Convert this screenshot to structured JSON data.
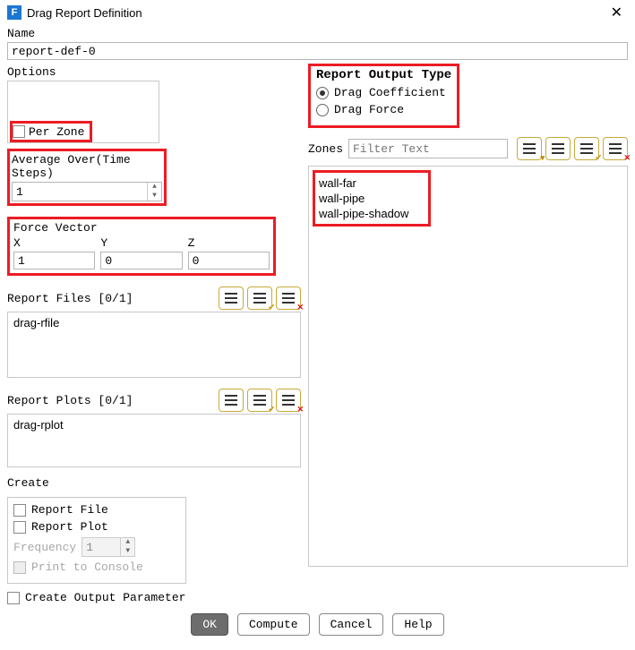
{
  "window": {
    "title": "Drag Report Definition",
    "icon_letter": "F"
  },
  "name": {
    "label": "Name",
    "value": "report-def-0"
  },
  "options": {
    "label": "Options",
    "per_zone": "Per Zone",
    "avg_over_label": "Average Over(Time Steps)",
    "avg_over_value": "1"
  },
  "force_vector": {
    "label": "Force Vector",
    "x_label": "X",
    "y_label": "Y",
    "z_label": "Z",
    "x": "1",
    "y": "0",
    "z": "0"
  },
  "report_files": {
    "label": "Report Files [0/1]",
    "items": [
      "drag-rfile"
    ]
  },
  "report_plots": {
    "label": "Report Plots [0/1]",
    "items": [
      "drag-rplot"
    ]
  },
  "create": {
    "label": "Create",
    "report_file": "Report File",
    "report_plot": "Report Plot",
    "frequency_label": "Frequency",
    "frequency_value": "1",
    "print_console": "Print to Console"
  },
  "create_output_param": "Create Output Parameter",
  "output_type": {
    "label": "Report Output Type",
    "drag_coef": "Drag Coefficient",
    "drag_force": "Drag Force",
    "selected": "drag_coef"
  },
  "zones": {
    "label": "Zones",
    "placeholder": "Filter Text",
    "items": [
      "wall-far",
      "wall-pipe",
      "wall-pipe-shadow"
    ]
  },
  "buttons": {
    "ok": "OK",
    "compute": "Compute",
    "cancel": "Cancel",
    "help": "Help"
  }
}
